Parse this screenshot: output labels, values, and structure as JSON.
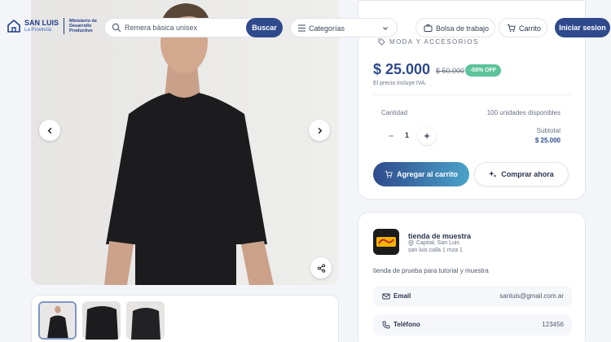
{
  "header": {
    "logo_brand": "SAN LUIS",
    "logo_sub": "La Provincia",
    "logo_ministry": "Ministerio de Desarrollo Productivo",
    "search_value": "Remera básica unisex",
    "search_button": "Buscar",
    "categories_label": "Categorías",
    "job_board_label": "Bolsa de trabajo",
    "cart_label": "Carrito",
    "login_label": "Iniciar sesion"
  },
  "product": {
    "category": "MODA Y ACCESORIOS",
    "price": "$ 25.000",
    "old_price": "$ 50.000",
    "discount": "-50% OFF",
    "iva_note": "El precio incluye IVA.",
    "quantity_label": "Cantidad",
    "stock": "100 unidades disponibles",
    "quantity": "1",
    "subtotal_label": "Subtotal",
    "subtotal_value": "$ 25.000",
    "add_to_cart": "Agregar al carrito",
    "buy_now": "Comprar ahora"
  },
  "store": {
    "name": "tienda de muestra",
    "location": "Capital, San Luis",
    "address": "san luis calla 1 mza 1",
    "description": "tienda de prueba para tutorial y muestra",
    "email_label": "Email",
    "email_value": "sanluis@gmail.com.ar",
    "phone_label": "Teléfono",
    "phone_value": "123456"
  },
  "colors": {
    "primary": "#2f4a8c",
    "discount_badge": "#5cc39a",
    "background": "#f3f5f9"
  }
}
